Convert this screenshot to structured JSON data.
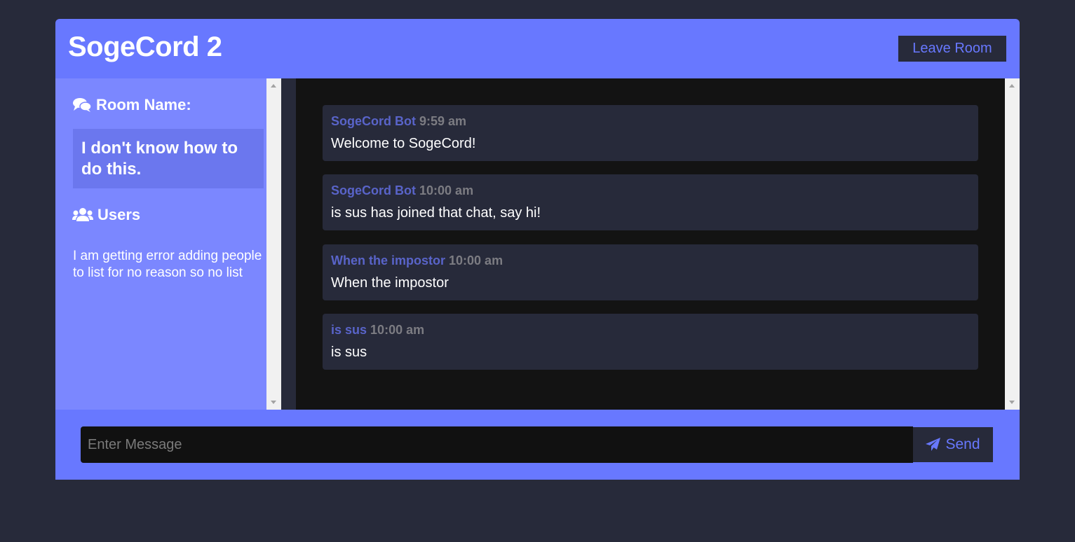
{
  "header": {
    "title": "SogeCord 2",
    "leave_label": "Leave Room"
  },
  "sidebar": {
    "room_heading": "Room Name:",
    "room_name": "I don't know how to do this.",
    "users_heading": "Users",
    "users_text": "I am getting error adding people to list for no reason so no list"
  },
  "messages": [
    {
      "user": "SogeCord Bot",
      "time": "9:59 am",
      "text": "Welcome to SogeCord!"
    },
    {
      "user": "SogeCord Bot",
      "time": "10:00 am",
      "text": "is sus has joined that chat, say hi!"
    },
    {
      "user": "When the impostor",
      "time": "10:00 am",
      "text": "When the impostor"
    },
    {
      "user": "is sus",
      "time": "10:00 am",
      "text": "is sus"
    }
  ],
  "composer": {
    "placeholder": "Enter Message",
    "value": "",
    "send_label": "Send"
  },
  "icons": {
    "room": "comments-icon",
    "users": "users-icon",
    "send": "paper-plane-icon"
  },
  "colors": {
    "accent": "#6878ff",
    "background": "#272a3a",
    "chat_background": "#131313",
    "username": "#5964c9"
  }
}
